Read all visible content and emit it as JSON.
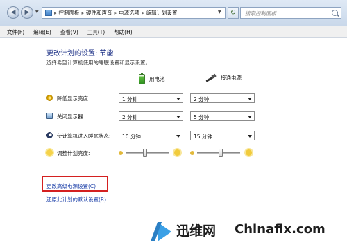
{
  "address_bar": {
    "breadcrumbs": [
      "控制面板",
      "硬件和声音",
      "电源选项",
      "编辑计划设置"
    ],
    "search_placeholder": "搜索控制面板"
  },
  "menu": [
    "文件(F)",
    "编辑(E)",
    "查看(V)",
    "工具(T)",
    "帮助(H)"
  ],
  "page": {
    "title": "更改计划的设置: 节能",
    "description": "选择希望计算机使用的睡眠设置和显示设置。"
  },
  "columns": {
    "battery": "用电池",
    "plugged_in": "接通电源"
  },
  "settings": [
    {
      "label": "降低显示亮度:",
      "icon": "dim-sun-icon",
      "battery": "1 分钟",
      "plugged_in": "2 分钟"
    },
    {
      "label": "关闭显示器:",
      "icon": "monitor-icon",
      "battery": "2 分钟",
      "plugged_in": "5 分钟"
    },
    {
      "label": "使计算机进入睡眠状态:",
      "icon": "moon-icon",
      "battery": "10 分钟",
      "plugged_in": "15 分钟"
    }
  ],
  "brightness": {
    "label": "调整计划亮度:",
    "battery_level": 0.45,
    "plugged_in_level": 0.55
  },
  "links": {
    "advanced": "更改高级电源设置(C)",
    "restore": "还原此计划的默认设置(R)"
  },
  "colors": {
    "title": "#1e3287",
    "link": "#1b3fa8",
    "highlight": "#d42020"
  },
  "watermark": {
    "brand": "迅维网",
    "domain": "Chinafix.com"
  }
}
